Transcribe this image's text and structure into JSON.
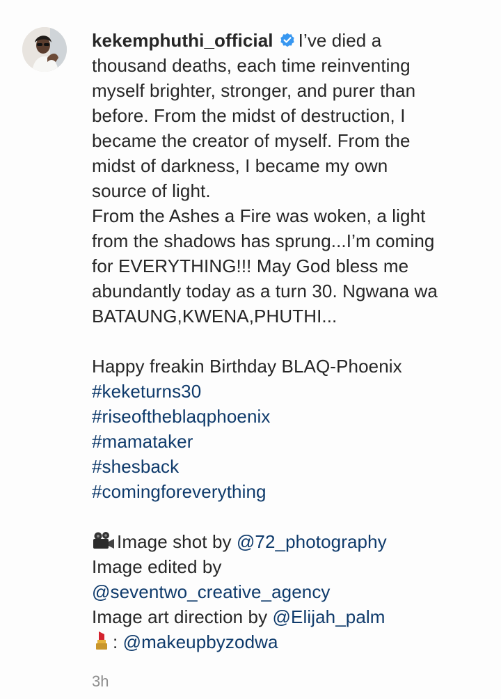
{
  "post": {
    "username": "kekemphuthi_official",
    "verified_icon": "verified-badge-icon",
    "caption_lines": [
      "I’ve died a",
      "thousand deaths, each time reinventing",
      "myself brighter, stronger, and purer than",
      "before. From the midst of destruction, I",
      "became the creator of myself. From the",
      "midst of darkness, I became my own",
      "source of light.",
      "From the Ashes a Fire was woken, a light",
      "from the shadows has sprung...I’m coming",
      "for EVERYTHING!!! May God bless me",
      "abundantly today as a turn 30. Ngwana wa",
      "BATAUNG,KWENA,PHUTHI..."
    ],
    "birthday_line": "Happy freakin Birthday BLAQ-Phoenix",
    "hashtags": [
      "#keketurns30",
      "#riseoftheblaqphoenix",
      "#mamataker",
      "#shesback",
      "#comingforeverything"
    ],
    "credits": {
      "shot_icon": "video-camera-icon",
      "shot_label": "Image shot by ",
      "shot_mention": "@72_photography",
      "edited_label": "Image edited by",
      "edited_mention": "@seventwo_creative_agency",
      "art_label": "Image art direction by ",
      "art_mention": "@Elijah_palm",
      "makeup_icon": "lipstick-icon",
      "makeup_sep": ": ",
      "makeup_mention": "@makeupbyzodwa"
    },
    "timestamp": "3h",
    "colors": {
      "text": "#262626",
      "link": "#0e3a6b",
      "verified": "#3897f0",
      "timestamp": "#8e8e8e"
    }
  }
}
